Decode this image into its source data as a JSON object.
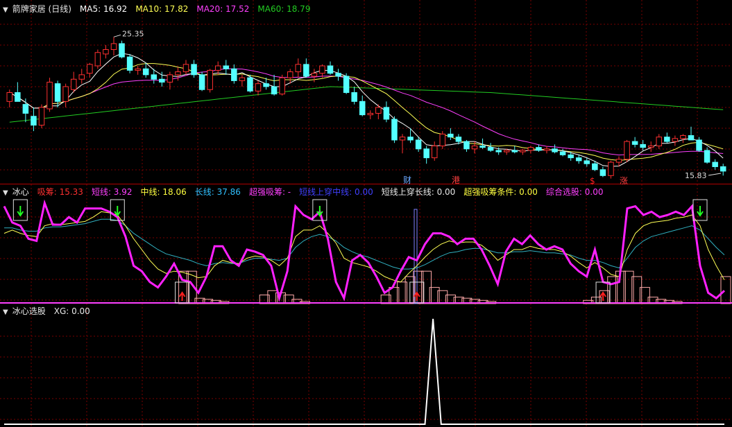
{
  "colors": {
    "bg": "#000000",
    "grid": "#7a0000",
    "separator": "#b00000",
    "up": "#ff3030",
    "down": "#54ffff",
    "ma5": "#ffffff",
    "ma10": "#ffff55",
    "ma20": "#ff40ff",
    "ma60": "#22cc22",
    "white_text": "#e8e8e8",
    "red_text": "#ff3030",
    "yellow_text": "#ffff40",
    "magenta_text": "#ff40ff",
    "green_text": "#40ff40",
    "cyan_text": "#30c0ff",
    "blue_text": "#4040ff"
  },
  "panel1": {
    "title": "箭牌家居 (日线)",
    "legends": [
      {
        "text": "MA5: 16.92",
        "color_key": "ma5"
      },
      {
        "text": "MA10: 17.82",
        "color_key": "ma10"
      },
      {
        "text": "MA20: 17.52",
        "color_key": "ma20"
      },
      {
        "text": "MA60: 18.79",
        "color_key": "ma60"
      }
    ]
  },
  "panel2": {
    "title": "冰心",
    "legends": [
      {
        "text": "吸筹: 15.33",
        "color_key": "red_text"
      },
      {
        "text": "短线: 3.92",
        "color_key": "magenta_text"
      },
      {
        "text": "中线: 18.06",
        "color_key": "yellow_text"
      },
      {
        "text": "长线: 37.86",
        "color_key": "cyan_text"
      },
      {
        "text": "超强吸筹: -",
        "color_key": "magenta_text"
      },
      {
        "text": "短线上穿中线: 0.00",
        "color_key": "blue_text"
      },
      {
        "text": "短线上穿长线: 0.00",
        "color_key": "white_text"
      },
      {
        "text": "超强吸筹条件: 0.00",
        "color_key": "yellow_text"
      },
      {
        "text": "综合选股: 0.00",
        "color_key": "magenta_text"
      }
    ]
  },
  "panel3": {
    "title": "冰心选股",
    "legends": [
      {
        "text": "XG: 0.00",
        "color_key": "white_text"
      }
    ]
  },
  "chart_data": [
    {
      "type": "candlestick",
      "title": "箭牌家居 (日线)",
      "annotations": {
        "high_label": "25.35",
        "low_label": "15.83",
        "markers": [
          "财",
          "港",
          "$",
          "涨"
        ]
      },
      "candles": [
        [
          21.0,
          21.8,
          20.6,
          21.6
        ],
        [
          21.6,
          22.3,
          21.2,
          21.0
        ],
        [
          20.8,
          21.2,
          19.6,
          20.2
        ],
        [
          20.0,
          20.6,
          19.0,
          19.4
        ],
        [
          19.4,
          20.8,
          19.2,
          20.6
        ],
        [
          20.5,
          22.6,
          20.3,
          22.3
        ],
        [
          22.2,
          22.4,
          20.6,
          21.0
        ],
        [
          21.0,
          22.2,
          20.6,
          22.0
        ],
        [
          21.8,
          23.0,
          21.6,
          22.5
        ],
        [
          22.5,
          23.2,
          22.2,
          22.8
        ],
        [
          22.9,
          23.6,
          22.6,
          23.5
        ],
        [
          23.4,
          24.5,
          23.2,
          24.3
        ],
        [
          24.2,
          24.8,
          23.9,
          24.5
        ],
        [
          24.5,
          25.35,
          24.1,
          24.9
        ],
        [
          24.9,
          25.1,
          23.9,
          24.0
        ],
        [
          24.0,
          24.2,
          22.9,
          23.1
        ],
        [
          23.1,
          23.4,
          22.8,
          23.2
        ],
        [
          23.2,
          23.6,
          22.6,
          22.8
        ],
        [
          22.8,
          23.2,
          22.2,
          22.5
        ],
        [
          22.5,
          23.0,
          22.0,
          22.3
        ],
        [
          22.3,
          23.0,
          21.8,
          22.8
        ],
        [
          22.8,
          23.3,
          22.4,
          23.0
        ],
        [
          23.0,
          23.8,
          22.8,
          23.5
        ],
        [
          23.5,
          23.8,
          22.6,
          22.8
        ],
        [
          22.8,
          23.0,
          21.7,
          21.8
        ],
        [
          21.8,
          23.2,
          21.6,
          23.1
        ],
        [
          23.1,
          23.7,
          22.8,
          23.4
        ],
        [
          23.4,
          23.8,
          22.8,
          23.2
        ],
        [
          23.2,
          23.5,
          22.2,
          22.4
        ],
        [
          22.4,
          22.8,
          22.0,
          22.6
        ],
        [
          22.6,
          22.8,
          21.6,
          21.7
        ],
        [
          21.7,
          22.4,
          21.4,
          22.2
        ],
        [
          22.2,
          22.6,
          21.8,
          22.0
        ],
        [
          22.0,
          22.8,
          21.4,
          21.5
        ],
        [
          21.5,
          22.8,
          21.4,
          22.6
        ],
        [
          22.6,
          23.2,
          22.2,
          23.0
        ],
        [
          23.0,
          23.9,
          22.6,
          23.5
        ],
        [
          23.5,
          23.9,
          22.6,
          22.7
        ],
        [
          22.7,
          23.2,
          22.3,
          22.9
        ],
        [
          22.9,
          23.5,
          22.6,
          23.4
        ],
        [
          23.4,
          23.7,
          22.8,
          22.9
        ],
        [
          22.9,
          23.2,
          22.4,
          22.7
        ],
        [
          22.7,
          22.9,
          21.5,
          21.6
        ],
        [
          21.6,
          22.0,
          20.8,
          21.0
        ],
        [
          21.0,
          21.4,
          20.0,
          20.1
        ],
        [
          20.1,
          20.4,
          19.8,
          20.2
        ],
        [
          20.2,
          20.8,
          19.8,
          20.6
        ],
        [
          20.6,
          21.0,
          19.6,
          19.8
        ],
        [
          19.8,
          20.0,
          18.2,
          18.4
        ],
        [
          18.4,
          18.8,
          17.5,
          18.6
        ],
        [
          18.6,
          19.2,
          18.2,
          18.4
        ],
        [
          18.4,
          18.6,
          17.6,
          17.8
        ],
        [
          17.8,
          18.0,
          16.8,
          17.2
        ],
        [
          17.2,
          18.3,
          17.0,
          18.0
        ],
        [
          18.0,
          19.0,
          17.8,
          18.8
        ],
        [
          18.8,
          19.2,
          18.4,
          18.6
        ],
        [
          18.6,
          18.8,
          18.1,
          18.3
        ],
        [
          18.3,
          18.4,
          17.6,
          17.8
        ],
        [
          17.8,
          18.3,
          17.5,
          18.0
        ],
        [
          18.0,
          18.5,
          17.8,
          17.9
        ],
        [
          17.9,
          18.2,
          17.6,
          17.7
        ],
        [
          17.7,
          17.9,
          17.4,
          17.6
        ],
        [
          17.6,
          17.8,
          17.4,
          17.7
        ],
        [
          17.7,
          18.0,
          17.5,
          17.6
        ],
        [
          17.6,
          17.8,
          17.4,
          17.7
        ],
        [
          17.7,
          18.0,
          17.5,
          17.9
        ],
        [
          17.9,
          18.1,
          17.6,
          17.7
        ],
        [
          17.7,
          18.0,
          17.5,
          17.8
        ],
        [
          17.8,
          18.1,
          17.5,
          17.6
        ],
        [
          17.6,
          17.8,
          17.3,
          17.4
        ],
        [
          17.4,
          17.6,
          17.0,
          17.2
        ],
        [
          17.2,
          17.4,
          16.8,
          17.0
        ],
        [
          17.0,
          17.2,
          16.6,
          16.8
        ],
        [
          16.8,
          17.0,
          16.3,
          16.4
        ],
        [
          16.4,
          16.6,
          15.9,
          16.0
        ],
        [
          16.0,
          17.0,
          15.8,
          16.9
        ],
        [
          16.9,
          17.3,
          16.6,
          17.1
        ],
        [
          17.1,
          18.4,
          16.9,
          18.3
        ],
        [
          18.3,
          18.6,
          17.9,
          18.1
        ],
        [
          18.1,
          18.4,
          17.7,
          17.9
        ],
        [
          17.9,
          18.3,
          17.6,
          18.0
        ],
        [
          18.0,
          18.8,
          17.8,
          18.6
        ],
        [
          18.6,
          18.9,
          18.2,
          18.3
        ],
        [
          18.3,
          18.7,
          18.0,
          18.5
        ],
        [
          18.5,
          18.8,
          18.2,
          18.7
        ],
        [
          18.7,
          19.3,
          18.5,
          18.4
        ],
        [
          18.4,
          18.6,
          17.6,
          17.7
        ],
        [
          17.7,
          17.9,
          16.8,
          16.9
        ],
        [
          16.9,
          17.1,
          16.4,
          16.6
        ],
        [
          16.6,
          16.8,
          16.0,
          16.3
        ]
      ],
      "ylim": [
        15.5,
        27.0
      ]
    },
    {
      "type": "line",
      "title": "冰心",
      "ylim": [
        0,
        100
      ],
      "series": [
        {
          "name": "短线",
          "values": [
            90,
            75,
            72,
            60,
            58,
            93,
            73,
            73,
            80,
            75,
            88,
            88,
            88,
            85,
            80,
            62,
            35,
            30,
            20,
            15,
            25,
            37,
            22,
            20,
            10,
            25,
            53,
            53,
            40,
            35,
            50,
            48,
            45,
            35,
            5,
            30,
            90,
            82,
            78,
            85,
            60,
            20,
            5,
            40,
            45,
            38,
            25,
            10,
            15,
            30,
            43,
            40,
            55,
            65,
            65,
            62,
            55,
            60,
            60,
            50,
            35,
            18,
            48,
            60,
            55,
            63,
            55,
            50,
            53,
            50,
            37,
            30,
            25,
            50,
            20,
            18,
            20,
            88,
            90,
            82,
            85,
            80,
            82,
            85,
            82,
            90,
            35,
            10,
            5,
            12
          ]
        },
        {
          "name": "中线",
          "values": [
            65,
            68,
            65,
            63,
            62,
            72,
            74,
            73,
            74,
            75,
            76,
            80,
            85,
            84,
            82,
            72,
            60,
            50,
            40,
            32,
            28,
            30,
            29,
            27,
            24,
            25,
            35,
            40,
            38,
            37,
            42,
            44,
            43,
            40,
            35,
            42,
            62,
            68,
            68,
            72,
            65,
            56,
            42,
            38,
            36,
            34,
            30,
            25,
            22,
            20,
            28,
            35,
            43,
            50,
            55,
            58,
            56,
            57,
            57,
            54,
            48,
            40,
            45,
            50,
            50,
            53,
            51,
            50,
            50,
            48,
            44,
            38,
            33,
            38,
            33,
            27,
            25,
            50,
            65,
            72,
            75,
            76,
            77,
            79,
            80,
            82,
            72,
            50,
            35,
            22
          ]
        },
        {
          "name": "长线",
          "values": [
            70,
            70,
            68,
            67,
            67,
            70,
            71,
            71,
            72,
            73,
            74,
            76,
            78,
            78,
            77,
            72,
            65,
            60,
            55,
            50,
            46,
            44,
            42,
            40,
            37,
            35,
            37,
            38,
            37,
            37,
            40,
            42,
            42,
            41,
            40,
            42,
            52,
            58,
            62,
            64,
            62,
            58,
            52,
            48,
            45,
            43,
            40,
            37,
            34,
            32,
            32,
            33,
            36,
            40,
            44,
            47,
            48,
            50,
            51,
            51,
            49,
            47,
            47,
            48,
            48,
            49,
            48,
            47,
            47,
            46,
            45,
            42,
            40,
            40,
            38,
            35,
            33,
            42,
            52,
            58,
            62,
            64,
            66,
            68,
            70,
            72,
            68,
            60,
            52,
            45
          ]
        },
        {
          "name": "吸筹",
          "values": [
            0,
            0,
            0,
            0,
            0,
            0,
            0,
            0,
            0,
            0,
            0,
            0,
            0,
            0,
            0,
            0,
            0,
            0,
            0,
            0,
            0,
            0,
            30,
            30,
            5,
            4,
            3,
            2,
            0,
            0,
            0,
            0,
            8,
            12,
            10,
            8,
            4,
            2,
            0,
            0,
            0,
            0,
            0,
            0,
            0,
            0,
            0,
            8,
            15,
            20,
            25,
            30,
            30,
            15,
            12,
            8,
            6,
            5,
            4,
            3,
            2,
            0,
            0,
            0,
            0,
            0,
            0,
            0,
            0,
            0,
            0,
            0,
            3,
            6,
            12,
            25,
            30,
            30,
            25,
            15,
            6,
            4,
            3,
            2,
            0,
            0,
            0,
            0,
            0,
            25
          ]
        }
      ],
      "signals": {
        "buy": [
          22,
          51,
          74
        ],
        "sell": [
          2,
          14,
          39,
          86
        ]
      }
    },
    {
      "type": "line",
      "title": "冰心选股",
      "ylim": [
        0,
        1
      ],
      "series": [
        {
          "name": "XG",
          "values": [
            0,
            0,
            0,
            0,
            0,
            0,
            0,
            0,
            0,
            0,
            0,
            0,
            0,
            0,
            0,
            0,
            0,
            0,
            0,
            0,
            0,
            0,
            0,
            0,
            0,
            0,
            0,
            0,
            0,
            0,
            0,
            0,
            0,
            0,
            0,
            0,
            0,
            0,
            0,
            0,
            0,
            0,
            0,
            0,
            0,
            0,
            0,
            0,
            0,
            0,
            0,
            0,
            0,
            1,
            0,
            0,
            0,
            0,
            0,
            0,
            0,
            0,
            0,
            0,
            0,
            0,
            0,
            0,
            0,
            0,
            0,
            0,
            0,
            0,
            0,
            0,
            0,
            0,
            0,
            0,
            0,
            0,
            0,
            0,
            0,
            0,
            0,
            0,
            0,
            0
          ]
        }
      ]
    }
  ]
}
